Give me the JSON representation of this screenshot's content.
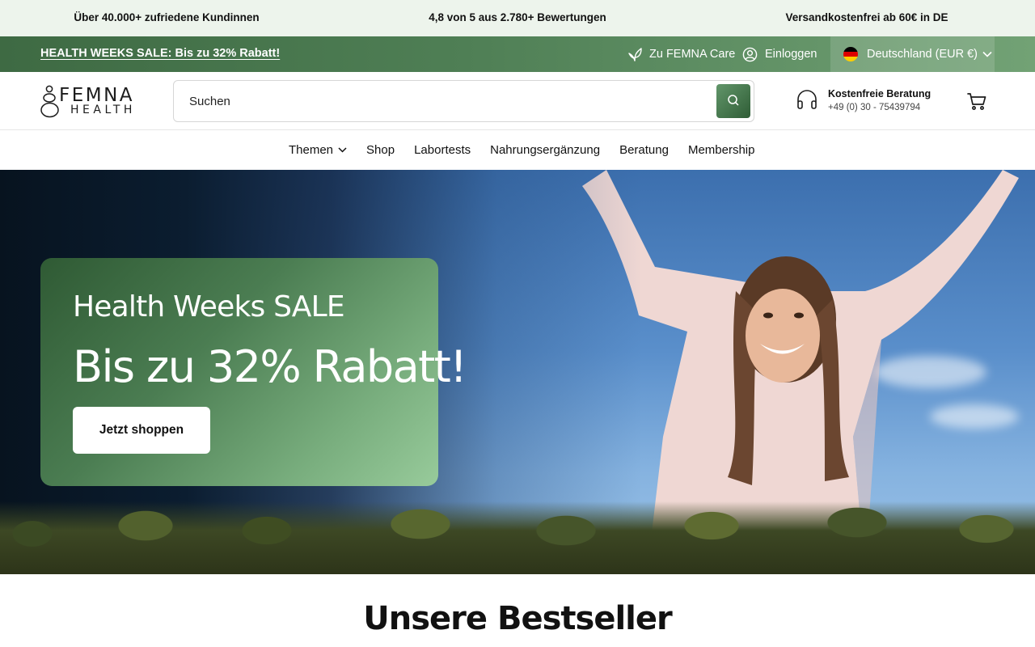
{
  "trust_bar": {
    "items": [
      "Über 40.000+ zufriedene Kundinnen",
      "4,8 von 5 aus 2.780+ Bewertungen",
      "Versandkostenfrei ab 60€ in DE"
    ]
  },
  "announcement": {
    "sale_link": "HEALTH WEEKS SALE: Bis zu 32% Rabatt!",
    "care_link": "Zu FEMNA Care",
    "login": "Einloggen",
    "country": "Deutschland (EUR €)"
  },
  "header": {
    "logo_line1": "FEMNA",
    "logo_line2": "HEALTH",
    "search_placeholder": "Suchen",
    "consult_title": "Kostenfreie Beratung",
    "consult_phone": "+49 (0) 30 - 75439794"
  },
  "nav": {
    "items": [
      "Themen",
      "Shop",
      "Labortests",
      "Nahrungsergänzung",
      "Beratung",
      "Membership"
    ]
  },
  "hero": {
    "subtitle": "Health Weeks SALE",
    "title": "Bis zu 32% Rabatt!",
    "cta": "Jetzt shoppen"
  },
  "bestseller": {
    "title": "Unsere Bestseller"
  },
  "colors": {
    "trust_bg": "#edf4ec",
    "brand_green": "#3e6a43",
    "hero_card_start": "#2f5a34",
    "hero_card_end": "#98cb9b"
  },
  "icons": {
    "care": "leaf-icon",
    "login": "user-icon",
    "country": "germany-flag-icon",
    "dropdown": "chevron-down-icon",
    "search": "search-icon",
    "consult": "headphones-icon",
    "cart": "cart-icon"
  }
}
